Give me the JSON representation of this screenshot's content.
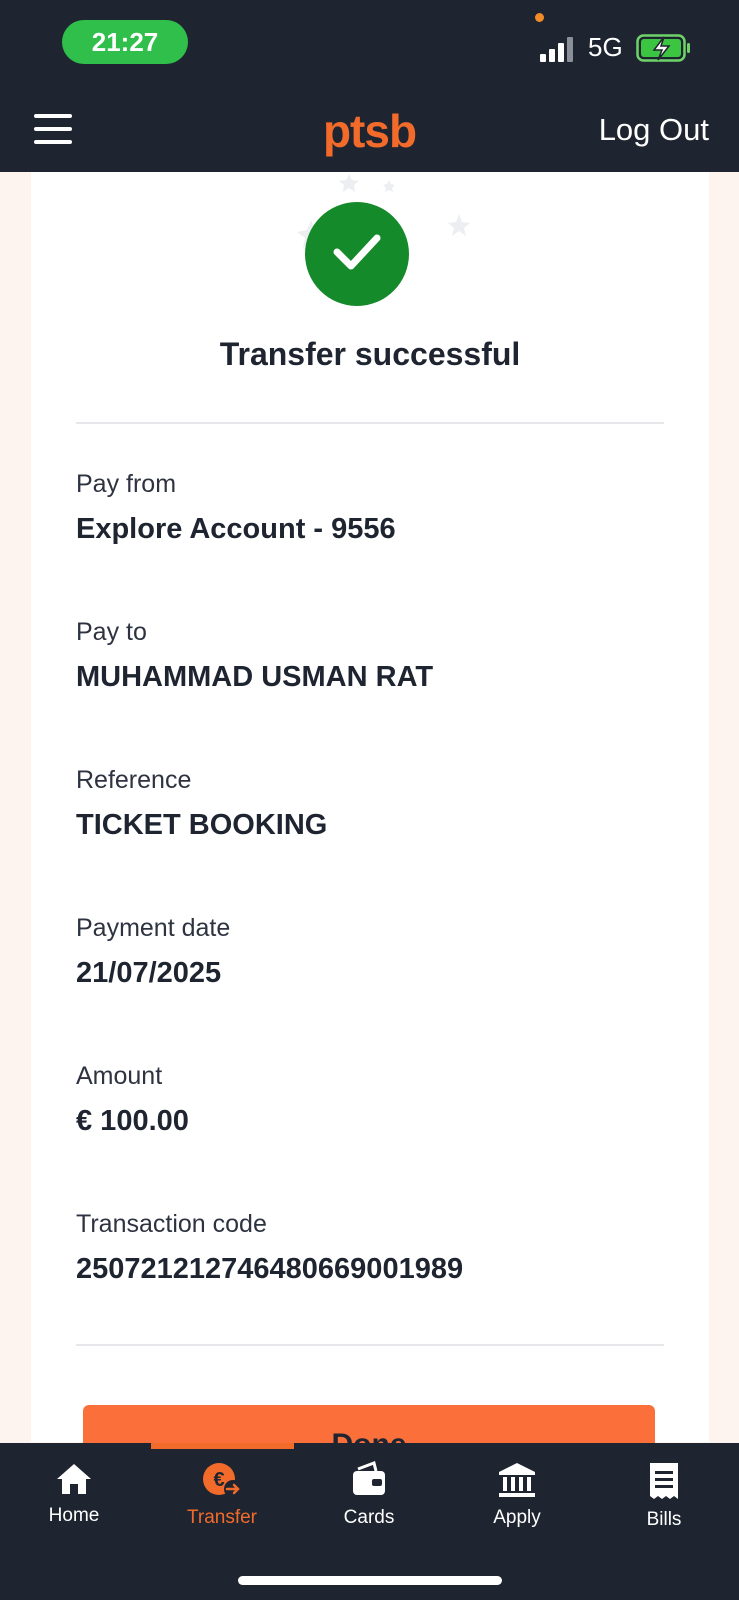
{
  "status_bar": {
    "time": "21:27",
    "network": "5G",
    "icons": [
      "signal-icon",
      "battery-charging-icon"
    ]
  },
  "header": {
    "logo_text": "ptsb",
    "logout_label": "Log Out",
    "menu_icon": "hamburger-menu-icon"
  },
  "colors": {
    "brand_orange": "#f26b2a",
    "button_orange": "#fb6f3b",
    "success_green": "#158a2a",
    "dark": "#1e2430"
  },
  "confirmation": {
    "title": "Transfer successful",
    "icon": "checkmark-icon",
    "fields": [
      {
        "label": "Pay from",
        "value": "Explore Account - 9556"
      },
      {
        "label": "Pay to",
        "value": "MUHAMMAD USMAN RAT"
      },
      {
        "label": "Reference",
        "value": "TICKET BOOKING"
      },
      {
        "label": "Payment date",
        "value": "21/07/2025"
      },
      {
        "label": "Amount",
        "value": "€ 100.00"
      },
      {
        "label": "Transaction code",
        "value": "250721212746480669001989"
      }
    ],
    "done_label": "Done"
  },
  "nav": {
    "items": [
      {
        "label": "Home",
        "icon": "home-icon",
        "active": false
      },
      {
        "label": "Transfer",
        "icon": "euro-transfer-icon",
        "active": true
      },
      {
        "label": "Cards",
        "icon": "wallet-icon",
        "active": false
      },
      {
        "label": "Apply",
        "icon": "bank-icon",
        "active": false
      },
      {
        "label": "Bills",
        "icon": "receipt-icon",
        "active": false
      }
    ]
  }
}
